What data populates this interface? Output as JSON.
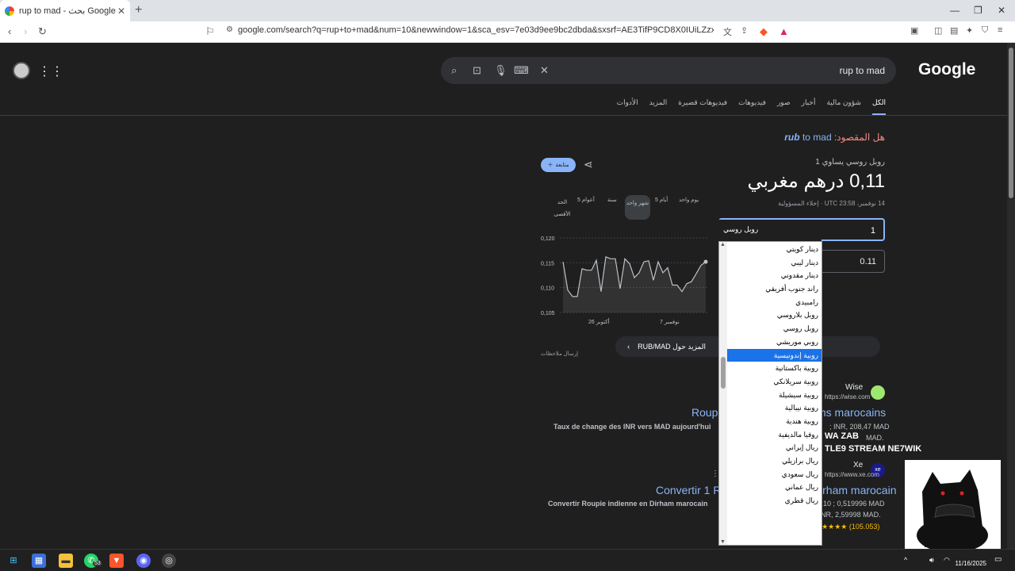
{
  "browser": {
    "tab_title": "rup to mad - بحث Google",
    "new_tab": "+",
    "url": "google.com/search?q=rup+to+mad&num=10&newwindow=1&sca_esv=7e03d9ee9bc2dbda&sxsrf=AE3TifP9CD8X0IUiLZzxvd9tALES7arWoA%..."
  },
  "search": {
    "query": "rup to mad",
    "logo": "Google"
  },
  "nav_tabs": [
    "الكل",
    "شؤون مالية",
    "أخبار",
    "صور",
    "فيديوهات",
    "فيديوهات قصيرة",
    "المزيد",
    "الأدوات"
  ],
  "did_you_mean": {
    "label": "هل المقصود:",
    "suggestion_bold": "rub",
    "suggestion_rest": "to mad"
  },
  "converter": {
    "follow_label": "متابعة",
    "equals_label": "1 روبل روسي يساوي",
    "value": "0,11 درهم مغربي",
    "timestamp": "14 نوفمبر، 23:58 UTC · إخلاء المسؤولية",
    "ranges": [
      "يوم واحد",
      "5 أيام",
      "شهر واحد",
      "سنة",
      "5 أعوام",
      "الحد الأقصى"
    ],
    "input_amount": "1",
    "input_currency": "روبل روسي",
    "output_amount": "0.11",
    "more_button": "المزيد حول RUB/MAD",
    "feedback": "إرسال ملاحظات"
  },
  "dropdown": {
    "options": [
      "دينار كويتي",
      "دينار ليبي",
      "دينار مقدوني",
      "راند جنوب أفريقي",
      "رامبيدي",
      "روبل بلاروسي",
      "روبل روسي",
      "روبي موريشي",
      "روبية إندونيسية",
      "روبية باكستانية",
      "روبية سريلانكي",
      "روبية سيشيلة",
      "روبية نيبالية",
      "روبية هندية",
      "روفيا مالديفية",
      "ريال إيراني",
      "ريال برازيلي",
      "ريال سعودي",
      "ريال عماني",
      "ريال قطري"
    ],
    "selected_index": 8
  },
  "chart_data": {
    "type": "line",
    "x_tick_labels": [
      "26 أكتوبر",
      "7 نوفمبر"
    ],
    "yticks": [
      0.105,
      0.11,
      0.115,
      0.12
    ],
    "ylim": [
      0.105,
      0.12
    ],
    "y_tick_labels": [
      "0,105",
      "0,110",
      "0,115",
      "0,120"
    ],
    "values": [
      0.1152,
      0.1095,
      0.1082,
      0.1082,
      0.1138,
      0.1135,
      0.1135,
      0.1155,
      0.1092,
      0.1162,
      0.1158,
      0.1158,
      0.1098,
      0.1158,
      0.1148,
      0.112,
      0.113,
      0.1152,
      0.1154,
      0.1115,
      0.1152,
      0.113,
      0.114,
      0.1105,
      0.1105,
      0.1092,
      0.1108,
      0.1112,
      0.1128,
      0.1145,
      0.1152
    ],
    "line_color": "#bdc1c6",
    "grid": true
  },
  "results": [
    {
      "site": "Wise",
      "url": "https://wise.com",
      "title": "Roupie indienne en Dirhams marocains",
      "snippet": "Taux de change des INR vers MAD aujourd'hui",
      "snippet2": "; INR, 208,47 MAD",
      "snippet3": "MAD.",
      "favicon_color": "#9fe870"
    },
    {
      "site": "Xe",
      "url": "https://www.xe.com",
      "title": "Convertir 1 Roupie indienne en Dirham marocain",
      "snippet": "Convertir Roupie indienne en Dirham marocain",
      "snippet2": "10 ; 0,519996 MAD",
      "snippet3": "INR, 1,03999 MAD ; 25 INR, 2,59998 MAD.",
      "rating": "4,8 ★★★★★ (105.053)",
      "favicon_color": "#1a1a8c"
    }
  ],
  "overlay": {
    "line1": "WA ZAB",
    "line2": "TLE9 STREAM NE7WIK"
  },
  "taskbar": {
    "whatsapp_badge": "53",
    "date": "11/16/2025"
  }
}
